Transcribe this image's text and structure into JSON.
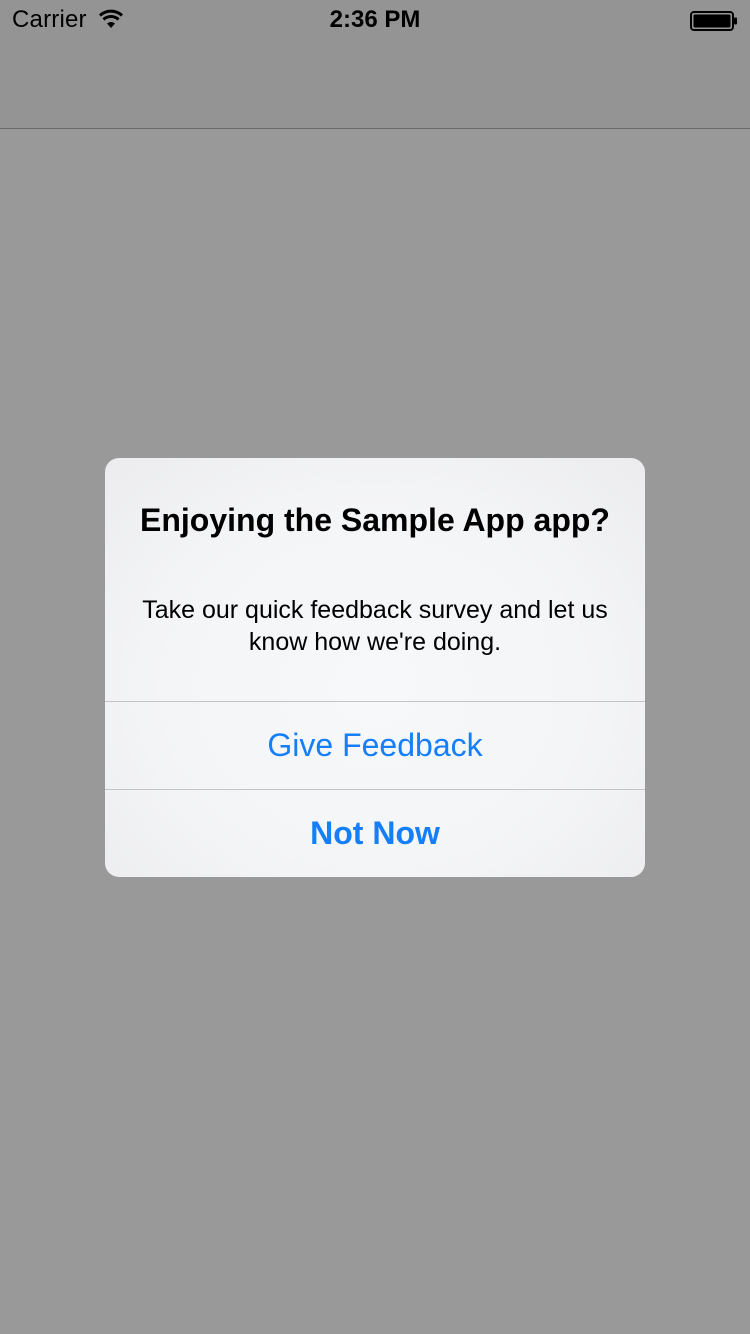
{
  "status_bar": {
    "carrier": "Carrier",
    "time": "2:36 PM",
    "icons": [
      "wifi-icon",
      "battery-icon"
    ]
  },
  "alert": {
    "title": "Enjoying the Sample App app?",
    "message": "Take our quick feedback survey and let us know how we're doing.",
    "buttons": [
      {
        "label": "Give Feedback",
        "style": "default"
      },
      {
        "label": "Not Now",
        "style": "bold"
      }
    ]
  },
  "colors": {
    "accent": "#147efb",
    "overlay": "rgba(0,0,0,0.4)",
    "background": "#ffffff"
  }
}
